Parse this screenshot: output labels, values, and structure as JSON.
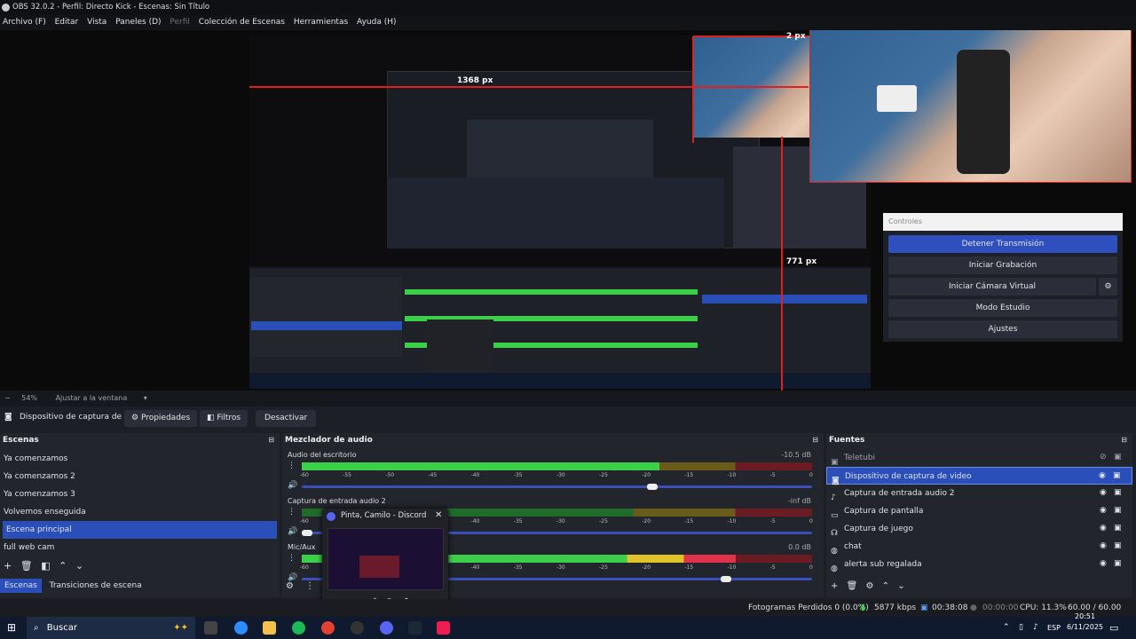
{
  "window": {
    "title": "OBS 32.0.2 - Perfil: Directo Kick - Escenas: Sin Título"
  },
  "menu": [
    "Archivo (F)",
    "Editar",
    "Vista",
    "Paneles (D)",
    "Perfil",
    "Colección de Escenas",
    "Herramientas",
    "Ayuda (H)"
  ],
  "preview": {
    "measure_top": "2 px",
    "measure_left": "1368 px",
    "measure_bottom": "771 px"
  },
  "controls": {
    "title": "Controles",
    "stream": "Detener Transmisión",
    "record": "Iniciar Grabación",
    "vcam": "Iniciar Cámara Virtual",
    "studio": "Modo Estudio",
    "settings": "Ajustes"
  },
  "zoom": {
    "minus": "−",
    "value": "54%",
    "fit": "Ajustar a la ventana"
  },
  "sourcebar": {
    "name": "Dispositivo de captura de v",
    "props": "Propiedades",
    "filters": "Filtros",
    "deactivate": "Desactivar"
  },
  "scenes": {
    "title": "Escenas",
    "items": [
      "Ya comenzamos",
      "Ya comenzamos 2",
      "Ya comenzamos 3",
      "Volvemos enseguida",
      "Escena principal",
      "full web cam"
    ],
    "selected": 4,
    "tab1": "Escenas",
    "tab2": "Transiciones de escena"
  },
  "mixer": {
    "title": "Mezclador de audio",
    "channels": [
      {
        "name": "Audio del escritorio",
        "db": "-10.5 dB",
        "level": 0.7
      },
      {
        "name": "Captura de entrada audio 2",
        "db": "-inf dB",
        "level": 0.0
      },
      {
        "name": "Mic/Aux",
        "db": "0.0 dB",
        "level": 0.85
      }
    ],
    "ticks": [
      "-60",
      "-55",
      "-50",
      "-45",
      "-40",
      "-35",
      "-30",
      "-25",
      "-20",
      "-15",
      "-10",
      "-5",
      "0"
    ]
  },
  "sources": {
    "title": "Fuentes",
    "items": [
      {
        "name": "Teletubi",
        "icon": "image-icon",
        "hidden": true
      },
      {
        "name": "Dispositivo de captura de video",
        "icon": "camera-icon",
        "selected": true
      },
      {
        "name": "Captura de entrada audio 2",
        "icon": "mic-icon"
      },
      {
        "name": "Captura de pantalla",
        "icon": "monitor-icon"
      },
      {
        "name": "Captura de juego",
        "icon": "gamepad-icon"
      },
      {
        "name": "chat",
        "icon": "globe-icon"
      },
      {
        "name": "alerta sub regalada",
        "icon": "globe-icon"
      }
    ]
  },
  "discord": {
    "title": "Pinta, Camilo - Discord"
  },
  "status": {
    "dropped": "Fotogramas Perdidos 0 (0.0%)",
    "bitrate": "5877 kbps",
    "stream_time": "00:38:08",
    "rec_time": "00:00:00",
    "cpu": "CPU: 11.3%",
    "fps": "60.00 / 60.00 FPS"
  },
  "taskbar": {
    "search": "Buscar",
    "lang": "ESP",
    "time": "20:51",
    "date": "6/11/2025"
  },
  "colors": {
    "accent": "#2a4fb8",
    "meter_green": "#3ccf4a",
    "meter_red": "#6a1c22"
  }
}
